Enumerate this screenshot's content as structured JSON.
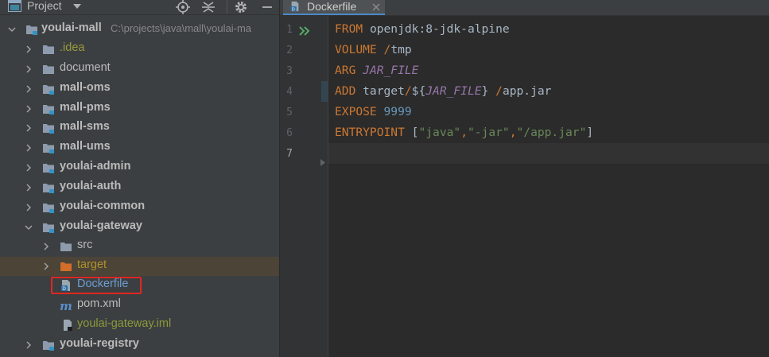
{
  "panel": {
    "title": "Project",
    "root": {
      "name": "youlai-mall",
      "path": "C:\\projects\\java\\mall\\youlai-ma"
    }
  },
  "tree": {
    "idea": ".idea",
    "document": "document",
    "mall_oms": "mall-oms",
    "mall_pms": "mall-pms",
    "mall_sms": "mall-sms",
    "mall_ums": "mall-ums",
    "youlai_admin": "youlai-admin",
    "youlai_auth": "youlai-auth",
    "youlai_common": "youlai-common",
    "youlai_gateway": "youlai-gateway",
    "src": "src",
    "target": "target",
    "dockerfile": "Dockerfile",
    "pom": "pom.xml",
    "iml": "youlai-gateway.iml",
    "youlai_registry": "youlai-registry"
  },
  "editor": {
    "tab": "Dockerfile",
    "line_numbers": [
      "1",
      "2",
      "3",
      "4",
      "5",
      "6",
      "7"
    ],
    "code": {
      "l1": {
        "kw": "FROM",
        "rest": " openjdk:8-jdk-alpine"
      },
      "l2": {
        "kw": "VOLUME",
        "sp": " ",
        "slash": "/",
        "rest": "tmp"
      },
      "l3": {
        "kw": "ARG",
        "sp": " ",
        "var": "JAR_FILE"
      },
      "l4": {
        "kw": "ADD",
        "a": " target",
        "slash1": "/",
        "b": "${",
        "var": "JAR_FILE",
        "c": "}",
        "sp": " ",
        "slash2": "/",
        "d": "app.jar"
      },
      "l5": {
        "kw": "EXPOSE",
        "sp": " ",
        "num": "9999"
      },
      "l6": {
        "kw": "ENTRYPOINT",
        "sp": " ",
        "open": "[",
        "s1": "\"java\"",
        "c1": ",",
        "s2": "\"-jar\"",
        "c2": ",",
        "s3": "\"/app.jar\"",
        "close": "]"
      }
    }
  },
  "colors": {
    "keyword": "#cc7832",
    "string": "#6a8759",
    "number": "#6897bb",
    "variable": "#9876aa",
    "highlight_box": "#e0271f"
  },
  "icons": [
    "project-view-icon",
    "dropdown-icon",
    "locate-icon",
    "collapse-icon",
    "gear-icon",
    "run-icon",
    "docker-file-icon",
    "maven-icon",
    "module-folder-icon",
    "folder-icon"
  ]
}
